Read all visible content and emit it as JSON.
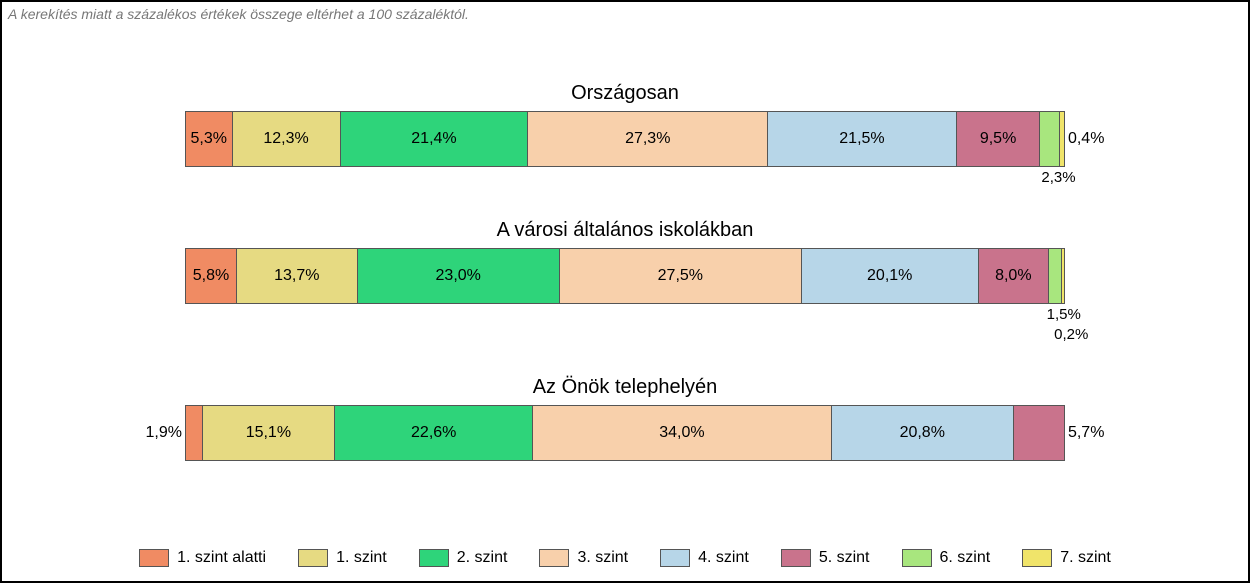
{
  "note": "A kerekítés miatt a százalékos értékek összege eltérhet a 100 százaléktól.",
  "colors": {
    "l0": "#f08b63",
    "l1": "#e6da82",
    "l2": "#2ed47a",
    "l3": "#f8d0ab",
    "l4": "#b7d6e8",
    "l5": "#c9738c",
    "l6": "#a8e67e",
    "l7": "#f0e46a"
  },
  "legend": [
    {
      "key": "l0",
      "label": "1. szint alatti"
    },
    {
      "key": "l1",
      "label": "1. szint"
    },
    {
      "key": "l2",
      "label": "2. szint"
    },
    {
      "key": "l3",
      "label": "3. szint"
    },
    {
      "key": "l4",
      "label": "4. szint"
    },
    {
      "key": "l5",
      "label": "5. szint"
    },
    {
      "key": "l6",
      "label": "6. szint"
    },
    {
      "key": "l7",
      "label": "7. szint"
    }
  ],
  "groups": [
    {
      "title": "Országosan",
      "segments": [
        {
          "key": "l0",
          "value": 5.3,
          "label": "5,3%",
          "show": "inside"
        },
        {
          "key": "l1",
          "value": 12.3,
          "label": "12,3%",
          "show": "inside"
        },
        {
          "key": "l2",
          "value": 21.4,
          "label": "21,4%",
          "show": "inside"
        },
        {
          "key": "l3",
          "value": 27.3,
          "label": "27,3%",
          "show": "inside"
        },
        {
          "key": "l4",
          "value": 21.5,
          "label": "21,5%",
          "show": "inside"
        },
        {
          "key": "l5",
          "value": 9.5,
          "label": "9,5%",
          "show": "inside"
        },
        {
          "key": "l6",
          "value": 2.3,
          "label": "2,3%",
          "show": "below"
        },
        {
          "key": "l7",
          "value": 0.4,
          "label": "0,4%",
          "show": "right"
        }
      ]
    },
    {
      "title": "A városi általános iskolákban",
      "segments": [
        {
          "key": "l0",
          "value": 5.8,
          "label": "5,8%",
          "show": "inside"
        },
        {
          "key": "l1",
          "value": 13.7,
          "label": "13,7%",
          "show": "inside"
        },
        {
          "key": "l2",
          "value": 23.0,
          "label": "23,0%",
          "show": "inside"
        },
        {
          "key": "l3",
          "value": 27.5,
          "label": "27,5%",
          "show": "inside"
        },
        {
          "key": "l4",
          "value": 20.1,
          "label": "20,1%",
          "show": "inside"
        },
        {
          "key": "l5",
          "value": 8.0,
          "label": "8,0%",
          "show": "inside"
        },
        {
          "key": "l6",
          "value": 1.5,
          "label": "1,5%",
          "show": "below"
        },
        {
          "key": "l7",
          "value": 0.2,
          "label": "0,2%",
          "show": "below2"
        }
      ]
    },
    {
      "title": "Az Önök telephelyén",
      "segments": [
        {
          "key": "l0",
          "value": 1.9,
          "label": "1,9%",
          "show": "left"
        },
        {
          "key": "l1",
          "value": 15.1,
          "label": "15,1%",
          "show": "inside"
        },
        {
          "key": "l2",
          "value": 22.6,
          "label": "22,6%",
          "show": "inside"
        },
        {
          "key": "l3",
          "value": 34.0,
          "label": "34,0%",
          "show": "inside"
        },
        {
          "key": "l4",
          "value": 20.8,
          "label": "20,8%",
          "show": "inside"
        },
        {
          "key": "l5",
          "value": 5.7,
          "label": "5,7%",
          "show": "right"
        }
      ]
    }
  ],
  "chart_data": {
    "type": "bar",
    "stacked": true,
    "orientation": "horizontal",
    "unit": "percent",
    "title": "",
    "note": "A kerekítés miatt a százalékos értékek összege eltérhet a 100 százaléktól.",
    "categories": [
      "Országosan",
      "A városi általános iskolákban",
      "Az Önök telephelyén"
    ],
    "series": [
      {
        "name": "1. szint alatti",
        "values": [
          5.3,
          5.8,
          1.9
        ],
        "color": "#f08b63"
      },
      {
        "name": "1. szint",
        "values": [
          12.3,
          13.7,
          15.1
        ],
        "color": "#e6da82"
      },
      {
        "name": "2. szint",
        "values": [
          21.4,
          23.0,
          22.6
        ],
        "color": "#2ed47a"
      },
      {
        "name": "3. szint",
        "values": [
          27.3,
          27.5,
          34.0
        ],
        "color": "#f8d0ab"
      },
      {
        "name": "4. szint",
        "values": [
          21.5,
          20.1,
          20.8
        ],
        "color": "#b7d6e8"
      },
      {
        "name": "5. szint",
        "values": [
          9.5,
          8.0,
          5.7
        ],
        "color": "#c9738c"
      },
      {
        "name": "6. szint",
        "values": [
          2.3,
          1.5,
          0
        ],
        "color": "#a8e67e"
      },
      {
        "name": "7. szint",
        "values": [
          0.4,
          0.2,
          0
        ],
        "color": "#f0e46a"
      }
    ],
    "xlabel": "",
    "ylabel": "",
    "xlim": [
      0,
      100
    ]
  }
}
